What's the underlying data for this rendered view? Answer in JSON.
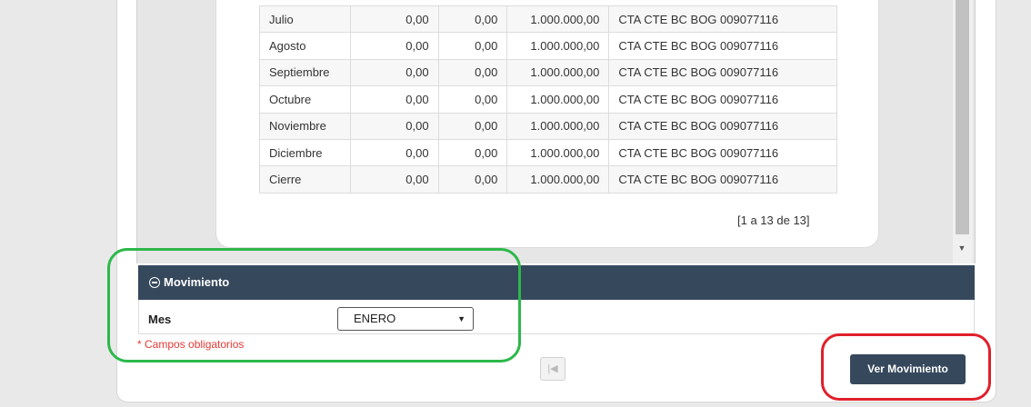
{
  "table": {
    "rows": [
      {
        "month": "Julio",
        "a": "0,00",
        "b": "0,00",
        "c": "1.000.000,00",
        "account": "CTA CTE BC BOG 009077116"
      },
      {
        "month": "Agosto",
        "a": "0,00",
        "b": "0,00",
        "c": "1.000.000,00",
        "account": "CTA CTE BC BOG 009077116"
      },
      {
        "month": "Septiembre",
        "a": "0,00",
        "b": "0,00",
        "c": "1.000.000,00",
        "account": "CTA CTE BC BOG 009077116"
      },
      {
        "month": "Octubre",
        "a": "0,00",
        "b": "0,00",
        "c": "1.000.000,00",
        "account": "CTA CTE BC BOG 009077116"
      },
      {
        "month": "Noviembre",
        "a": "0,00",
        "b": "0,00",
        "c": "1.000.000,00",
        "account": "CTA CTE BC BOG 009077116"
      },
      {
        "month": "Diciembre",
        "a": "0,00",
        "b": "0,00",
        "c": "1.000.000,00",
        "account": "CTA CTE BC BOG 009077116"
      },
      {
        "month": "Cierre",
        "a": "0,00",
        "b": "0,00",
        "c": "1.000.000,00",
        "account": "CTA CTE BC BOG 009077116"
      }
    ],
    "pager_text": "[1 a 13 de 13]"
  },
  "movimiento": {
    "header_title": "Movimiento",
    "mes_label": "Mes",
    "mes_selected": "ENERO",
    "required_note": "* Campos obligatorios"
  },
  "actions": {
    "first_page_glyph": "|◀",
    "ver_movimiento_label": "Ver Movimiento"
  },
  "icons": {
    "collapse": "minus-circle-icon",
    "select_caret": "caret-down-icon",
    "scroll_down": "scroll-down-arrow-icon"
  },
  "colors": {
    "header_bg": "#36485c",
    "button_bg": "#36485c",
    "required_text": "#e53935",
    "highlight_green": "#2db84a",
    "highlight_red": "#e0202a"
  }
}
